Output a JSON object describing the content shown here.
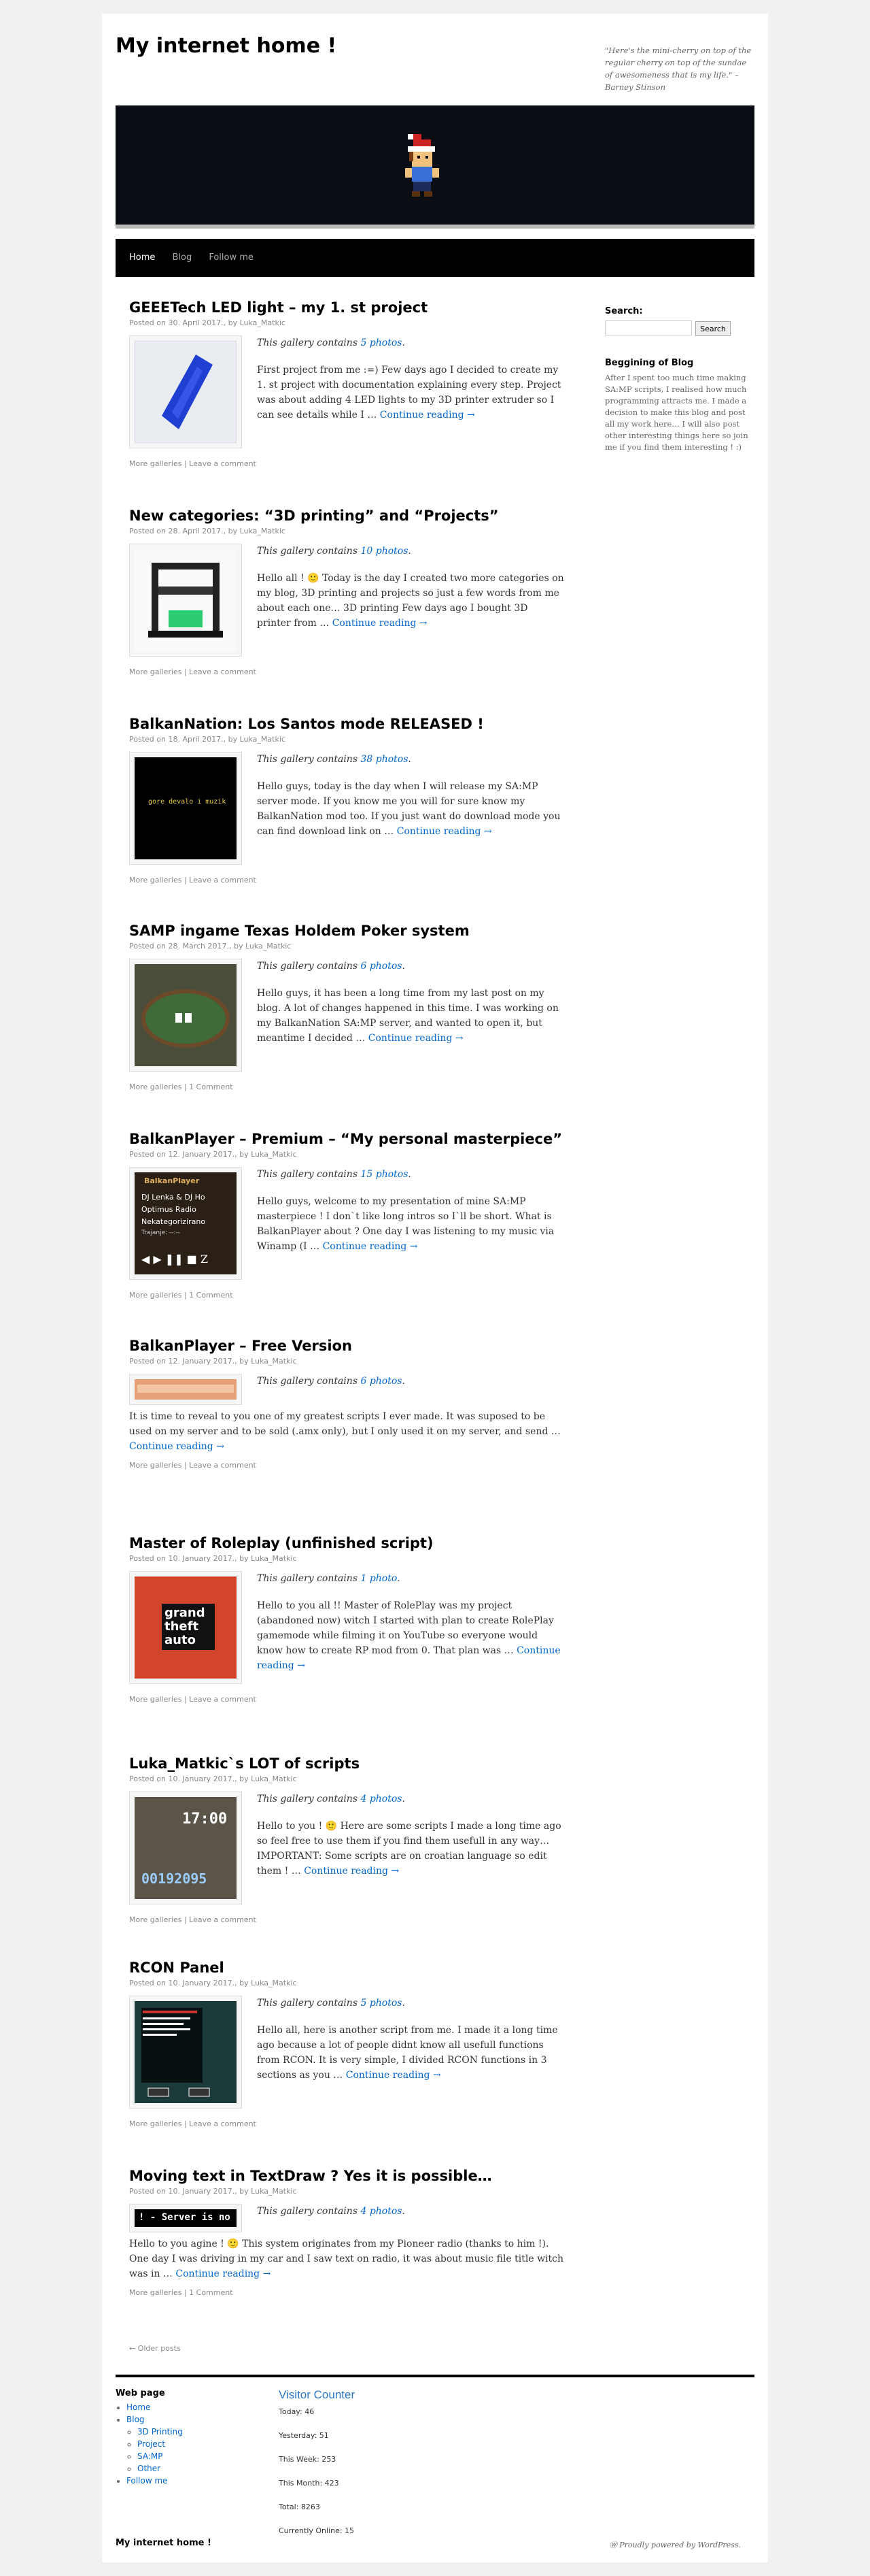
{
  "site": {
    "title": "My internet home !",
    "description": "\"Here's the mini-cherry on top of the regular cherry on top of the sundae of awesomeness that is my life.\" – Barney Stinson"
  },
  "nav": {
    "items": [
      "Home",
      "Blog",
      "Follow me"
    ]
  },
  "gallery_prefix": "This gallery contains",
  "posted_on": "Posted on",
  "by": "by",
  "more_galleries": "More galleries",
  "continue": "Continue reading →",
  "posts": [
    {
      "title": "GEEETech LED light – my 1. st project",
      "date": "30. April 2017.",
      "author": "Luka_Matkic",
      "photos": "5 photos",
      "excerpt": "First project from me :=) Few days ago I decided to create my 1. st project with documentation explaining every step. Project was about adding 4 LED lights to my 3D printer extruder so I can see details while I …",
      "comment": "Leave a comment"
    },
    {
      "title": "New categories: “3D printing” and “Projects”",
      "date": "28. April 2017.",
      "author": "Luka_Matkic",
      "photos": "10 photos",
      "excerpt": "Hello all ! 🙂 Today is the day I created two more categories on my blog, 3D printing and projects so just a few words from me about each one… 3D printing Few days ago I bought 3D printer from …",
      "comment": "Leave a comment"
    },
    {
      "title": "BalkanNation: Los Santos mode RELEASED !",
      "date": "18. April 2017.",
      "author": "Luka_Matkic",
      "photos": "38 photos",
      "excerpt": "Hello guys, today is the day when I will release my SA:MP server mode. If you know me you will for sure know my BalkanNation mod too. If you just want do download mode you can find download link on …",
      "comment": "Leave a comment"
    },
    {
      "title": "SAMP ingame Texas Holdem Poker system",
      "date": "28. March 2017.",
      "author": "Luka_Matkic",
      "photos": "6 photos",
      "excerpt": "Hello guys, it has been a long time from my last post on my blog. A lot of changes happened in this time. I was working on my BalkanNation SA:MP server, and wanted to open it, but meantime I decided …",
      "comment": "1 Comment"
    },
    {
      "title": "BalkanPlayer – Premium – “My personal masterpiece”",
      "date": "12. January 2017.",
      "author": "Luka_Matkic",
      "photos": "15 photos",
      "excerpt": "Hello guys, welcome to my presentation of mine SA:MP masterpiece ! I don`t like long intros so I`ll be short. What is BalkanPlayer about ?            One day I was listening to my music via Winamp (I …",
      "comment": "1 Comment"
    },
    {
      "title": "BalkanPlayer – Free Version",
      "date": "12. January 2017.",
      "author": "Luka_Matkic",
      "photos": "6 photos",
      "excerpt": "It is time to reveal to you one of my greatest scripts I ever made. It was suposed to be used on my server and to be sold (.amx only), but I only used it on my server, and send …",
      "comment": "Leave a comment"
    },
    {
      "title": "Master of Roleplay (unfinished script)",
      "date": "10. January 2017.",
      "author": "Luka_Matkic",
      "photos": "1 photo",
      "excerpt": "Hello to you all !! Master of RolePlay was my project (abandoned now) witch I started with plan to create RolePlay gamemode while filming it on YouTube so everyone would know how to create RP mod from 0. That plan was …",
      "comment": "Leave a comment"
    },
    {
      "title": "Luka_Matkic`s LOT of scripts",
      "date": "10. January 2017.",
      "author": "Luka_Matkic",
      "photos": "4 photos",
      "excerpt": "Hello to you ! 🙂 Here are some scripts I made a long time ago so feel free to use them if you find them usefull in any way… IMPORTANT: Some scripts are on croatian language so edit them ! …",
      "comment": "Leave a comment"
    },
    {
      "title": "RCON Panel",
      "date": "10. January 2017.",
      "author": "Luka_Matkic",
      "photos": "5 photos",
      "excerpt": "Hello all, here is another script from me. I made it a long time ago because a lot of people didnt know all usefull functions from RCON. It is very simple, I divided RCON functions in 3 sections as you …",
      "comment": "Leave a comment"
    },
    {
      "title": "Moving text in TextDraw ? Yes it is possible…",
      "date": "10. January 2017.",
      "author": "Luka_Matkic",
      "photos": "4 photos",
      "excerpt": "Hello to you agine ! 🙂 This system originates from my Pioneer radio (thanks to him !). One day I was driving in my car and I saw text on radio, it was about music file title witch was in …",
      "comment": "1 Comment"
    }
  ],
  "thumbs": {
    "bn_text": "gore devalo i muzik",
    "player_lines": [
      "BalkanPlayer",
      "DJ Lenka & DJ Ho",
      "Optimus Radio",
      "Nekategorizirano",
      "Trajanje: --:--"
    ],
    "clock": "17:00",
    "counter": "00192095",
    "gta": "grand theft auto",
    "textdraw": "! - Server is no"
  },
  "sidebar": {
    "search_title": "Search:",
    "search_button": "Search",
    "blog_title": "Beggining of Blog",
    "blog_text": "After I spent too much time making SA:MP scripts, I realised how much programming attracts me. I made a decision to make this blog and post all my work here… I will also post other interesting things here so join me if you find them interesting ! :)"
  },
  "older_posts": "← Older posts",
  "footer": {
    "web_title": "Web page",
    "menu": [
      "Home",
      "Blog",
      "Follow me"
    ],
    "submenu": [
      "3D Printing",
      "Project",
      "SA:MP",
      "Other"
    ],
    "counter_title": "Visitor Counter",
    "counter": [
      "Today: 46",
      "Yesterday: 51",
      "This Week: 253",
      "This Month: 423",
      "Total: 8263",
      "Currently Online: 15"
    ],
    "site_info": "My internet home !",
    "generator": "Proudly powered by WordPress."
  }
}
